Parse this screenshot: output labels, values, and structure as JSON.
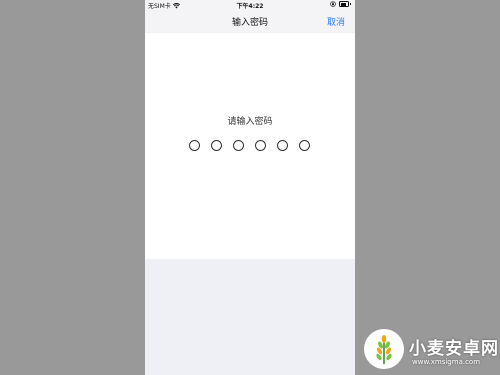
{
  "status_bar": {
    "carrier": "无SIM卡",
    "time": "下午4:22",
    "wifi_icon": "wifi-icon",
    "lock_icon": "orientation-lock-icon",
    "battery_icon": "battery-icon"
  },
  "nav": {
    "title": "输入密码",
    "cancel_label": "取消",
    "accent_color": "#2f7cf6"
  },
  "passcode": {
    "prompt": "请输入密码",
    "digit_count": 6,
    "entered_count": 0
  },
  "watermark": {
    "title": "小麦安卓网",
    "url": "www.xmsigma.com"
  }
}
